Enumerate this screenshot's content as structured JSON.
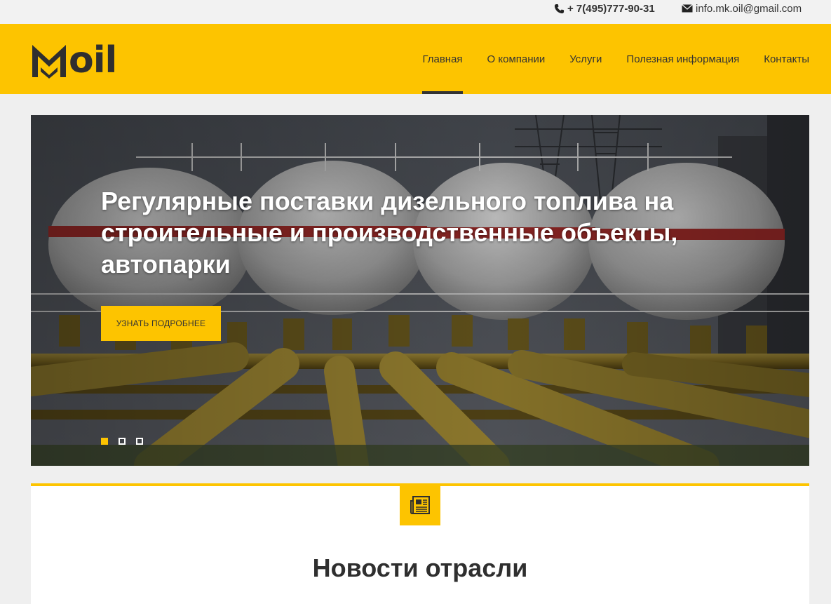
{
  "topbar": {
    "phone": "+ 7(495)777-90-31",
    "email": "info.mk.oil@gmail.com",
    "phone_icon": "phone-icon",
    "email_icon": "envelope-icon"
  },
  "logo": {
    "text": "oil"
  },
  "nav": [
    {
      "label": "Главная",
      "active": true
    },
    {
      "label": "О компании"
    },
    {
      "label": "Услуги"
    },
    {
      "label": "Полезная информация"
    },
    {
      "label": "Контакты"
    }
  ],
  "hero": {
    "title": "Регулярные поставки дизельного топлива на строительные и производственные объекты, автопарки",
    "button": "Узнать подробнее",
    "slides": 3,
    "active_slide": 1
  },
  "news": {
    "icon": "newspaper-icon",
    "title": "Новости отрасли"
  },
  "colors": {
    "accent": "#fdc400",
    "dark": "#2f2f2f"
  }
}
